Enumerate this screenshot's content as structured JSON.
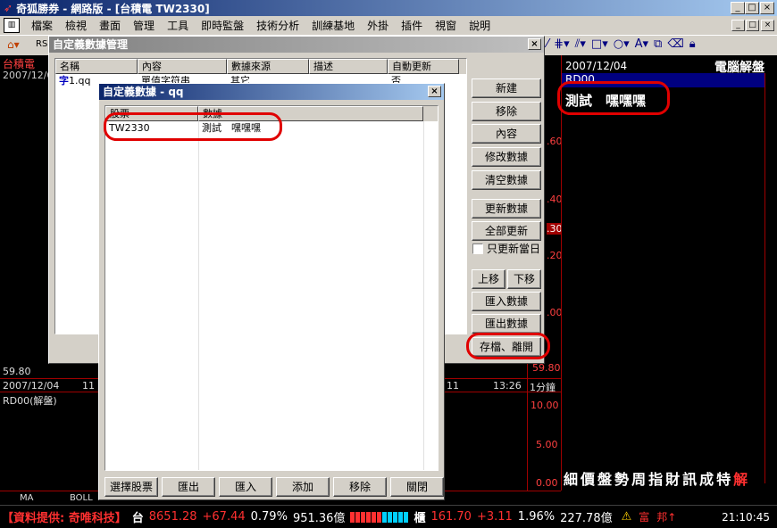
{
  "window": {
    "title": "奇狐勝券 - 網路版 - [台積電 TW2330]",
    "min": "_",
    "max": "□",
    "close": "×"
  },
  "menu": [
    "檔案",
    "檢視",
    "畫面",
    "管理",
    "工具",
    "即時監盤",
    "技術分析",
    "訓練基地",
    "外掛",
    "插件",
    "視窗",
    "說明"
  ],
  "toolbar": {
    "stub": "RS"
  },
  "chart": {
    "stock": "台積電",
    "date_top": "2007/12/0",
    "date_bottom": "2007/12/04",
    "time1": "11",
    "time2": "11",
    "time3": "13:26",
    "period": "1分鐘",
    "indicator": "RD00(解盤)",
    "axis_upper": [
      ".60",
      ".40",
      ".30",
      ".20",
      ".00",
      "59.80"
    ],
    "axis_lower": [
      "10.00",
      "5.00",
      "0.00"
    ],
    "tabs": [
      "MA",
      "BOLL"
    ],
    "left_price": "59.80"
  },
  "right_panel": {
    "date": "2007/12/04",
    "title": "電腦解盤",
    "code": "RD00",
    "content": "測試　嘿嘿嘿",
    "bottom_tabs": [
      "細",
      "價",
      "盤",
      "勢",
      "周",
      "指",
      "財",
      "訊",
      "成",
      "特",
      "解"
    ]
  },
  "manager_dialog": {
    "title": "自定義數據管理",
    "columns": [
      "名稱",
      "內容",
      "數據來源",
      "描述",
      "自動更新"
    ],
    "rows": [
      {
        "icon": "字",
        "name": "1.qq",
        "content": "單值字符串",
        "source": "其它",
        "desc": "",
        "auto": "否"
      }
    ],
    "buttons": [
      "新建",
      "移除",
      "內容",
      "修改數據",
      "清空數據",
      "更新數據",
      "全部更新"
    ],
    "checkbox_label": "只更新當日",
    "move_up": "上移",
    "move_down": "下移",
    "import": "匯入數據",
    "export": "匯出數據",
    "save_close": "存檔、離開"
  },
  "data_dialog": {
    "title": "自定義數據 - qq",
    "columns": [
      "股票",
      "數據"
    ],
    "rows": [
      {
        "stock": "TW2330",
        "data": "測試　嘿嘿嘿"
      }
    ],
    "buttons": [
      "選擇股票",
      "匯出",
      "匯入",
      "添加",
      "移除",
      "關閉"
    ]
  },
  "status": {
    "provider": "【資料提供: 奇唯科技】",
    "idx1_label": "台",
    "idx1_value": "8651.28",
    "idx1_change": "+67.44",
    "idx1_pct": "0.79%",
    "idx1_vol": "951.36億",
    "idx2_label": "櫃",
    "idx2_value": "161.70",
    "idx2_change": "+3.11",
    "idx2_pct": "1.96%",
    "idx2_vol": "227.78億",
    "icons_text": [
      "富",
      "邦↑"
    ],
    "time": "21:10:45"
  },
  "colors": {
    "accent": "#0a246a",
    "highlight": "#e00000",
    "up": "#ff3030",
    "chart_grid": "#a00000"
  }
}
